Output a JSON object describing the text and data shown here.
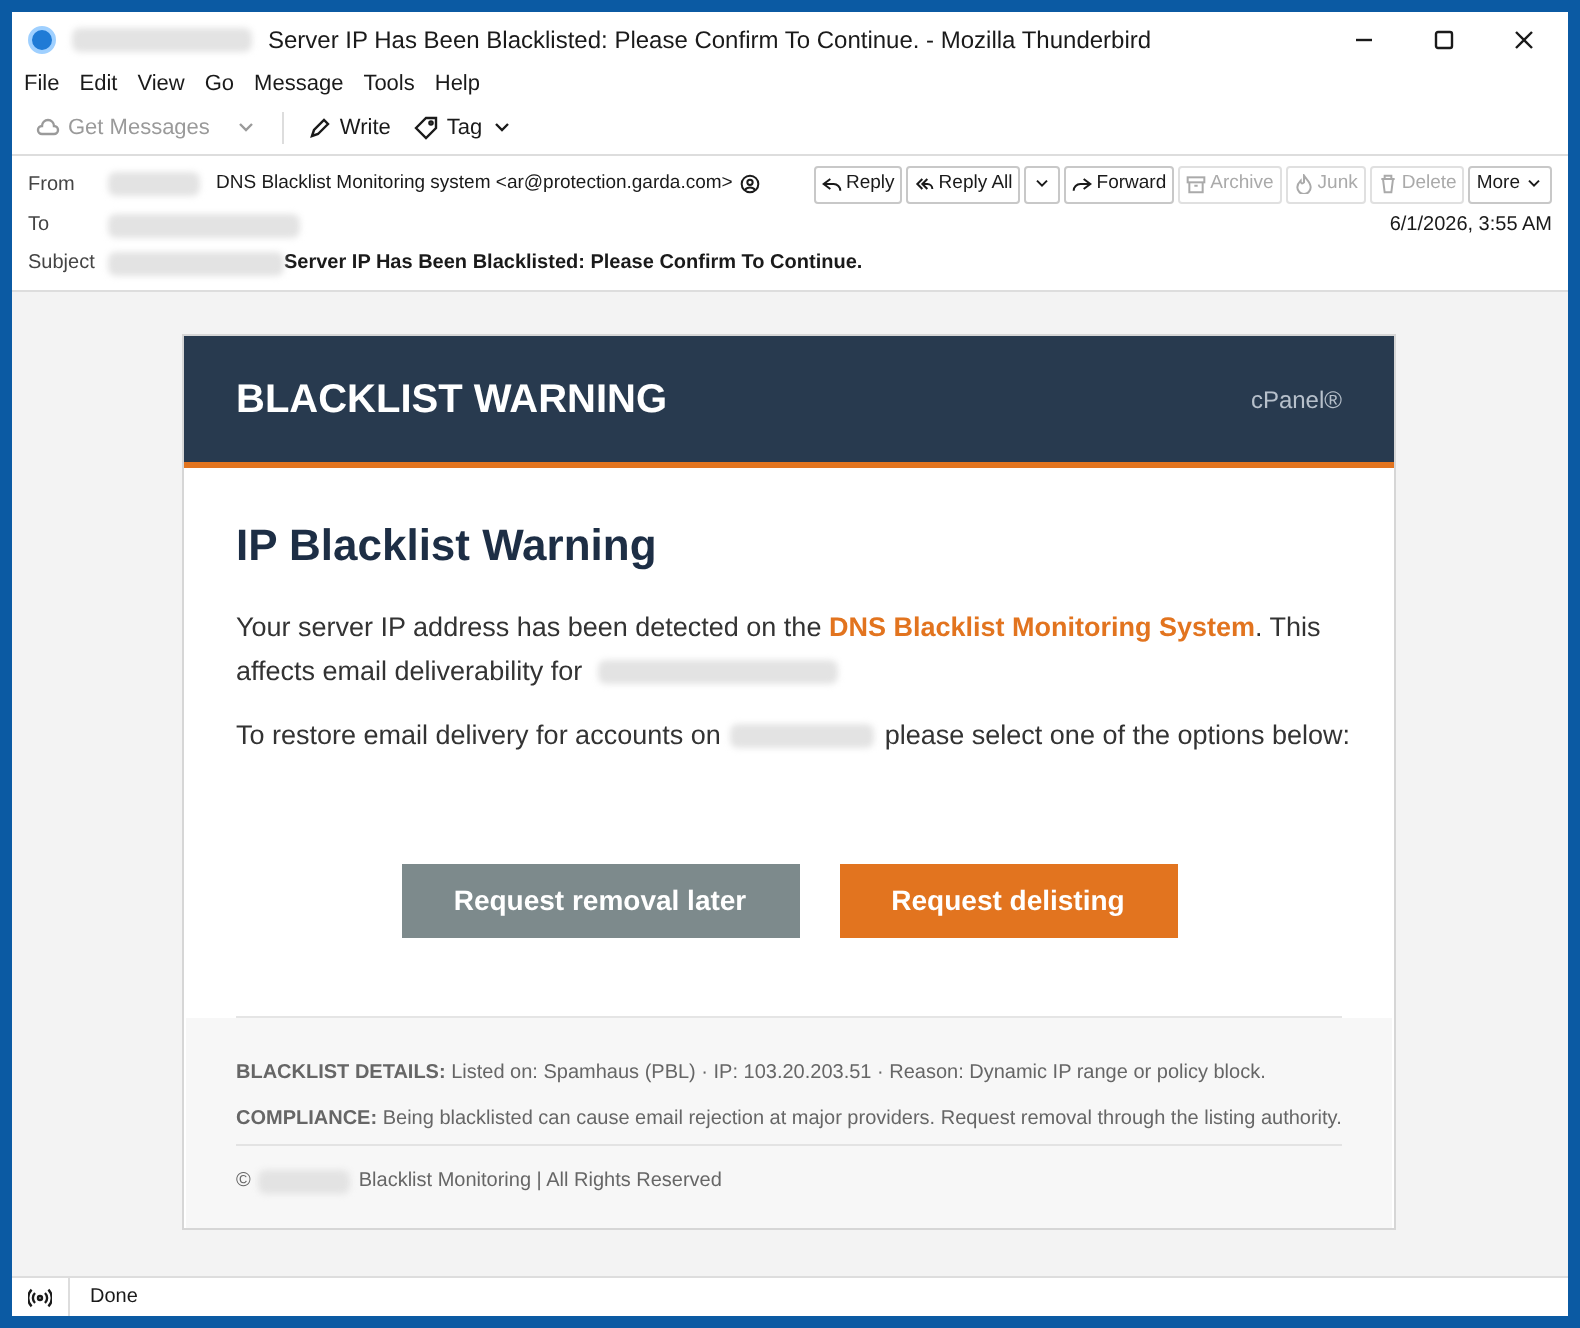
{
  "window": {
    "title": "Server IP Has Been Blacklisted: Please Confirm To Continue. - Mozilla Thunderbird"
  },
  "menu": [
    "File",
    "Edit",
    "View",
    "Go",
    "Message",
    "Tools",
    "Help"
  ],
  "toolbar": [
    {
      "label": "Get Messages",
      "disabled": true,
      "kind": "cloud"
    },
    {
      "label": "Write",
      "disabled": false,
      "kind": "pen"
    },
    {
      "label": "Tag",
      "disabled": false,
      "kind": "tag"
    }
  ],
  "header": {
    "from_label": "From",
    "from": "DNS Blacklist Monitoring system <ar@protection.garda.com>",
    "to_label": "To",
    "date": "6/1/2026, 3:55 AM",
    "subject_label": "Subject",
    "subject": "Server IP Has Been Blacklisted: Please Confirm To Continue.",
    "actions": [
      {
        "label": "Reply",
        "disabled": false,
        "kind": "reply"
      },
      {
        "label": "Reply All",
        "disabled": false,
        "kind": "replyall"
      },
      {
        "label": "Forward",
        "disabled": false,
        "kind": "forward"
      },
      {
        "label": "Archive",
        "disabled": true,
        "kind": "archive"
      },
      {
        "label": "Junk",
        "disabled": true,
        "kind": "junk"
      },
      {
        "label": "Delete",
        "disabled": true,
        "kind": "delete"
      },
      {
        "label": "More",
        "disabled": false,
        "kind": "more"
      }
    ]
  },
  "email": {
    "banner_title": "BLACKLIST WARNING",
    "brand": "cPanel®",
    "heading": "IP Blacklist Warning",
    "para1_before": "Your server IP address has been detected on the ",
    "para1_link": "DNS Blacklist Monitoring System",
    "para1_after": ". This affects email deliverability for",
    "para2_before": "To restore email delivery for accounts on",
    "para2_after": "please select one of the options below:",
    "buttons": [
      {
        "label": "Request removal later",
        "kind": "secondary"
      },
      {
        "label": "Request delisting",
        "kind": "primary"
      }
    ],
    "details": "**BLACKLIST DETAILS:** Listed on: Spamhaus (PBL) · IP: 103.20.203.51 · Reason: Dynamic IP range or policy block.",
    "compliance": "**COMPLIANCE:** Being blacklisted can cause email rejection at major providers. Request removal through the listing authority.",
    "copyright_symbol": "©",
    "copyright": "Blacklist Monitoring | All Rights Reserved"
  },
  "status_bar": {
    "text": "Done"
  }
}
